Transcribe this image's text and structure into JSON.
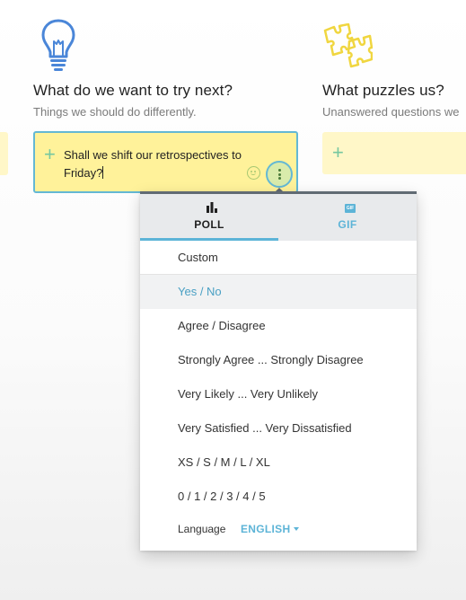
{
  "columns": {
    "next": {
      "icon": "lightbulb-icon",
      "title": "What do we want to try next?",
      "subtitle": "Things we should do differently."
    },
    "puzzles": {
      "icon": "puzzle-icon",
      "title": "What puzzles us?",
      "subtitle": "Unanswered questions we"
    }
  },
  "edit_card": {
    "text": "Shall we shift our retrospectives to Friday?",
    "emoji_icon": "smiley-icon",
    "more_icon": "kebab-menu-icon"
  },
  "menu": {
    "tabs": [
      {
        "label": "POLL",
        "icon": "bar-chart-icon",
        "active": true
      },
      {
        "label": "GIF",
        "icon": "gif-icon",
        "icon_text": "GIF",
        "active": false
      }
    ],
    "items": [
      "Custom",
      "Yes / No",
      "Agree / Disagree",
      "Strongly Agree ... Strongly Disagree",
      "Very Likely ... Very Unlikely",
      "Very Satisfied ... Very Dissatisfied",
      "XS / S / M / L / XL",
      "0 / 1 / 2 / 3 / 4 / 5"
    ],
    "selected_item": "Yes / No",
    "language_label": "Language",
    "language_value": "ENGLISH"
  },
  "colors": {
    "card_yellow": "#fff29a",
    "accent_blue": "#5db4d7",
    "plus_green": "#76c7a0",
    "selected_text": "#4aa0c4"
  }
}
